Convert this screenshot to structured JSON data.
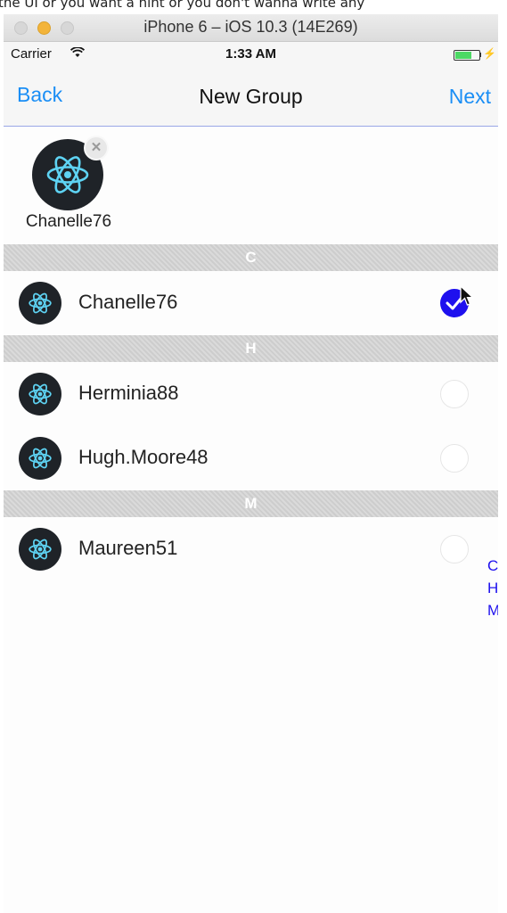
{
  "caption": "the UI or you want a hint or you don't wanna write any",
  "simulator": {
    "title": "iPhone 6 – iOS 10.3 (14E269)"
  },
  "status_bar": {
    "carrier": "Carrier",
    "time": "1:33 AM",
    "battery_level": 0.7,
    "battery_color": "#4cd964"
  },
  "nav": {
    "back_label": "Back",
    "title": "New Group",
    "next_label": "Next",
    "accent_color": "#1a8ef5"
  },
  "selected": [
    {
      "name": "Chanelle76",
      "avatar_icon": "react-logo-icon",
      "remove_icon": "remove-icon"
    }
  ],
  "sections": [
    {
      "letter": "C",
      "contacts": [
        {
          "name": "Chanelle76",
          "checked": true
        }
      ]
    },
    {
      "letter": "H",
      "contacts": [
        {
          "name": "Herminia88",
          "checked": false
        },
        {
          "name": "Hugh.Moore48",
          "checked": false
        }
      ]
    },
    {
      "letter": "M",
      "contacts": [
        {
          "name": "Maureen51",
          "checked": false
        }
      ]
    }
  ],
  "index": [
    "C",
    "H",
    "M"
  ],
  "check_color": "#1e10ee"
}
